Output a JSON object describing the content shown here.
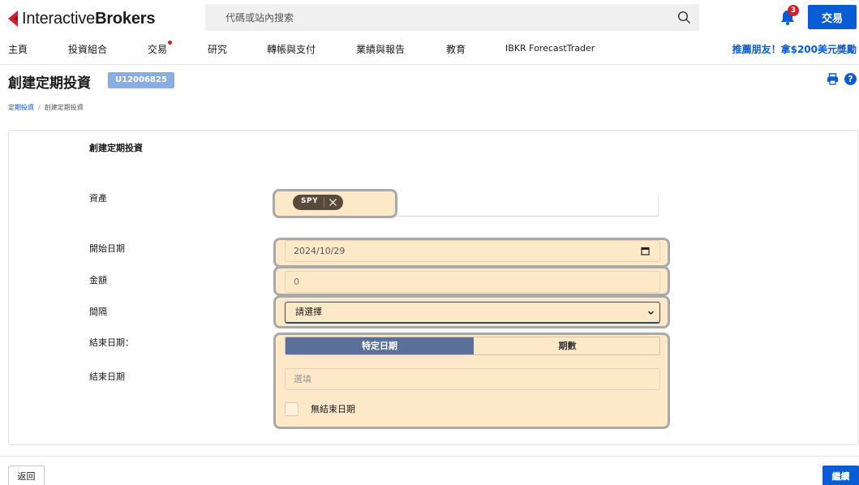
{
  "header": {
    "logo_regular": "Interactive",
    "logo_bold": "Brokers",
    "search_placeholder": "代碼或站內搜索",
    "notification_count": "3",
    "trade_label": "交易"
  },
  "nav": {
    "items": [
      {
        "label": "主頁"
      },
      {
        "label": "投資組合"
      },
      {
        "label": "交易"
      },
      {
        "label": "研究"
      },
      {
        "label": "轉帳與支付"
      },
      {
        "label": "業績與報告"
      },
      {
        "label": "教育"
      },
      {
        "label": "IBKR ForecastTrader"
      }
    ],
    "promo": "推薦朋友！拿$200美元獎勵"
  },
  "page": {
    "title": "創建定期投資",
    "account_id": "U12006825",
    "help_glyph": "?"
  },
  "breadcrumb": {
    "parent": "定期投資",
    "current": "創建定期投資"
  },
  "form": {
    "card_title": "創建定期投資",
    "asset_label": "資產",
    "asset_chip": "SPY",
    "start_date_label": "開始日期",
    "start_date_value": "2024/10/29",
    "amount_label": "金額",
    "amount_value": "0",
    "interval_label": "間隔",
    "interval_value": "請選擇",
    "end_type_label": "結束日期：",
    "end_type_options": [
      "特定日期",
      "期數"
    ],
    "end_date_label": "結束日期",
    "end_date_placeholder": "選填",
    "no_end_date_label": "無結束日期"
  },
  "footer": {
    "back_label": "返回",
    "continue_label": "繼續"
  },
  "colors": {
    "brand_blue": "#0a5bd6",
    "brand_red": "#d21f2b",
    "highlight_fill": "#fde9c8",
    "segment_active": "#5a7099"
  }
}
